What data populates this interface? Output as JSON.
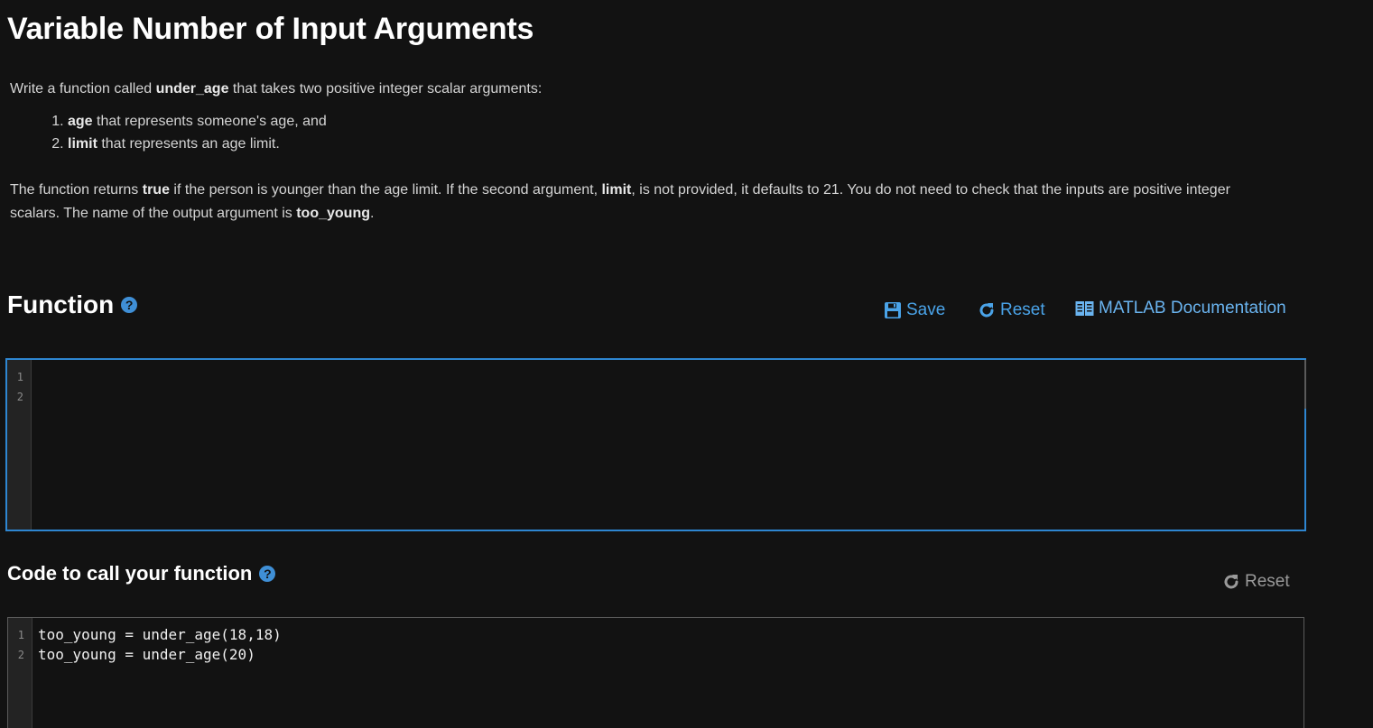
{
  "title": "Variable Number of Input Arguments",
  "description": {
    "intro_pre": "Write a function called ",
    "intro_name": "under_age",
    "intro_post": " that takes two positive integer scalar arguments:",
    "items": [
      {
        "bold": "age",
        "text": " that represents someone's age, and"
      },
      {
        "bold": "limit",
        "text": " that represents an age limit."
      }
    ],
    "p2_a": "The function returns ",
    "p2_true": "true",
    "p2_b": " if the person is younger than the age limit. If the second argument, ",
    "p2_limit": "limit",
    "p2_c": ", is not provided, it defaults to 21. You do not need to check that the inputs are positive integer scalars. The name of the output argument is ",
    "p2_out": "too_young",
    "p2_d": "."
  },
  "function_section": {
    "heading": "Function",
    "help": "?",
    "save_label": "Save",
    "reset_label": "Reset",
    "doc_label": "MATLAB Documentation",
    "lines": [
      "1",
      "2"
    ],
    "code": [
      "",
      ""
    ]
  },
  "call_section": {
    "heading": "Code to call your function",
    "help": "?",
    "reset_label": "Reset",
    "lines": [
      "1",
      "2"
    ],
    "code": [
      "too_young = under_age(18,18)",
      "too_young = under_age(20)"
    ]
  },
  "colors": {
    "background": "#121212",
    "accent": "#4aa3e8",
    "editor_border_active": "#2e86d1"
  }
}
